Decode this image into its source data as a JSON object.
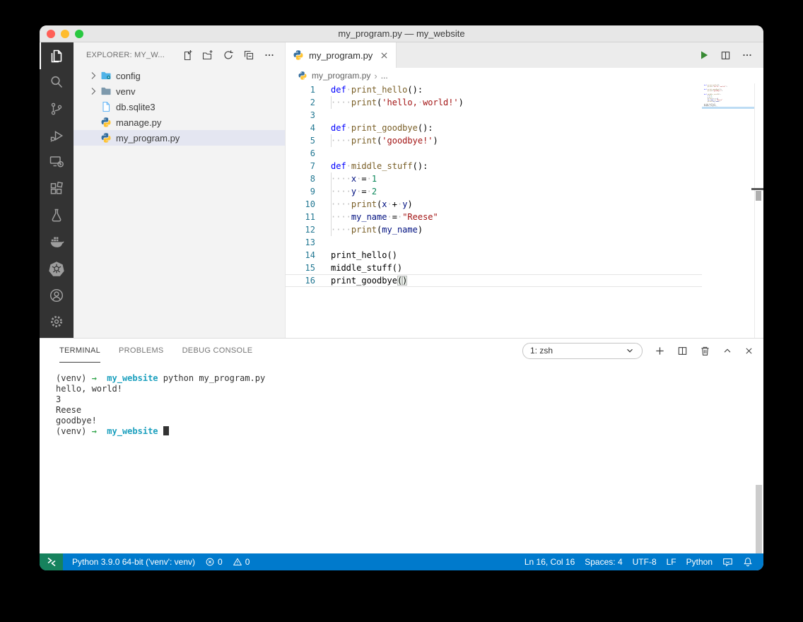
{
  "window": {
    "title": "my_program.py — my_website"
  },
  "activity_bar": {
    "items": [
      {
        "id": "explorer",
        "label": "Explorer",
        "active": true
      },
      {
        "id": "search",
        "label": "Search",
        "active": false
      },
      {
        "id": "source-control",
        "label": "Source Control",
        "active": false
      },
      {
        "id": "run-debug",
        "label": "Run and Debug",
        "active": false
      },
      {
        "id": "remote-explorer",
        "label": "Remote Explorer",
        "active": false
      },
      {
        "id": "extensions",
        "label": "Extensions",
        "active": false
      },
      {
        "id": "testing",
        "label": "Testing",
        "active": false
      },
      {
        "id": "docker",
        "label": "Docker",
        "active": false
      },
      {
        "id": "kubernetes",
        "label": "Kubernetes",
        "active": false
      }
    ],
    "bottom": [
      {
        "id": "accounts",
        "label": "Accounts",
        "active": false
      },
      {
        "id": "settings",
        "label": "Manage",
        "active": false
      }
    ]
  },
  "sidebar": {
    "title": "EXPLORER: MY_W...",
    "actions": [
      "new-file",
      "new-folder",
      "refresh",
      "collapse-all",
      "more"
    ],
    "tree": [
      {
        "label": "config",
        "icon": "folder-config",
        "chevron": true,
        "selected": false
      },
      {
        "label": "venv",
        "icon": "folder",
        "chevron": true,
        "selected": false
      },
      {
        "label": "db.sqlite3",
        "icon": "file",
        "chevron": false,
        "selected": false
      },
      {
        "label": "manage.py",
        "icon": "python",
        "chevron": false,
        "selected": false
      },
      {
        "label": "my_program.py",
        "icon": "python",
        "chevron": false,
        "selected": true
      }
    ]
  },
  "editor": {
    "tab": {
      "label": "my_program.py",
      "icon": "python"
    },
    "actions": [
      "run",
      "split-editor",
      "more"
    ],
    "breadcrumb": {
      "file": "my_program.py",
      "more": "..."
    },
    "code": [
      {
        "n": 1,
        "tokens": [
          [
            "kw",
            "def"
          ],
          [
            "ws",
            "·"
          ],
          [
            "fn",
            "print_hello"
          ],
          [
            "pl",
            "():"
          ]
        ]
      },
      {
        "n": 2,
        "indent": true,
        "tokens": [
          [
            "ws",
            "····"
          ],
          [
            "fn",
            "print"
          ],
          [
            "pl",
            "("
          ],
          [
            "str",
            "'hello,"
          ],
          [
            "ws",
            "·"
          ],
          [
            "str",
            "world!'"
          ],
          [
            "pl",
            ")"
          ]
        ]
      },
      {
        "n": 3,
        "tokens": []
      },
      {
        "n": 4,
        "tokens": [
          [
            "kw",
            "def"
          ],
          [
            "ws",
            "·"
          ],
          [
            "fn",
            "print_goodbye"
          ],
          [
            "pl",
            "():"
          ]
        ]
      },
      {
        "n": 5,
        "indent": true,
        "tokens": [
          [
            "ws",
            "····"
          ],
          [
            "fn",
            "print"
          ],
          [
            "pl",
            "("
          ],
          [
            "str",
            "'goodbye!'"
          ],
          [
            "pl",
            ")"
          ]
        ]
      },
      {
        "n": 6,
        "tokens": []
      },
      {
        "n": 7,
        "tokens": [
          [
            "kw",
            "def"
          ],
          [
            "ws",
            "·"
          ],
          [
            "fn",
            "middle_stuff"
          ],
          [
            "pl",
            "():"
          ]
        ]
      },
      {
        "n": 8,
        "indent": true,
        "tokens": [
          [
            "ws",
            "····"
          ],
          [
            "var",
            "x"
          ],
          [
            "ws",
            "·"
          ],
          [
            "pl",
            "="
          ],
          [
            "ws",
            "·"
          ],
          [
            "num",
            "1"
          ]
        ]
      },
      {
        "n": 9,
        "indent": true,
        "tokens": [
          [
            "ws",
            "····"
          ],
          [
            "var",
            "y"
          ],
          [
            "ws",
            "·"
          ],
          [
            "pl",
            "="
          ],
          [
            "ws",
            "·"
          ],
          [
            "num",
            "2"
          ]
        ]
      },
      {
        "n": 10,
        "indent": true,
        "tokens": [
          [
            "ws",
            "····"
          ],
          [
            "fn",
            "print"
          ],
          [
            "pl",
            "("
          ],
          [
            "var",
            "x"
          ],
          [
            "ws",
            "·"
          ],
          [
            "pl",
            "+"
          ],
          [
            "ws",
            "·"
          ],
          [
            "var",
            "y"
          ],
          [
            "pl",
            ")"
          ]
        ]
      },
      {
        "n": 11,
        "indent": true,
        "tokens": [
          [
            "ws",
            "····"
          ],
          [
            "var",
            "my_name"
          ],
          [
            "ws",
            "·"
          ],
          [
            "pl",
            "="
          ],
          [
            "ws",
            "·"
          ],
          [
            "str",
            "\"Reese\""
          ]
        ]
      },
      {
        "n": 12,
        "indent": true,
        "tokens": [
          [
            "ws",
            "····"
          ],
          [
            "fn",
            "print"
          ],
          [
            "pl",
            "("
          ],
          [
            "var",
            "my_name"
          ],
          [
            "pl",
            ")"
          ]
        ]
      },
      {
        "n": 13,
        "tokens": []
      },
      {
        "n": 14,
        "tokens": [
          [
            "pl",
            "print_hello()"
          ]
        ]
      },
      {
        "n": 15,
        "tokens": [
          [
            "pl",
            "middle_stuff()"
          ]
        ]
      },
      {
        "n": 16,
        "current": true,
        "tokens": [
          [
            "pl",
            "print_goodbye"
          ],
          [
            "bm",
            "("
          ],
          [
            "bm",
            ")"
          ]
        ]
      }
    ]
  },
  "panel": {
    "tabs": [
      {
        "label": "TERMINAL",
        "active": true
      },
      {
        "label": "PROBLEMS",
        "active": false
      },
      {
        "label": "DEBUG CONSOLE",
        "active": false
      }
    ],
    "shell_select": "1: zsh",
    "controls": [
      "add",
      "split-panel",
      "trash",
      "chevron-up",
      "close"
    ],
    "terminal": [
      [
        [
          "tp",
          "(venv) "
        ],
        [
          "ta",
          "→"
        ],
        [
          "tp",
          "  "
        ],
        [
          "td",
          "my_website"
        ],
        [
          "tp",
          " python my_program.py"
        ]
      ],
      [
        [
          "tp",
          "hello, world!"
        ]
      ],
      [
        [
          "tp",
          "3"
        ]
      ],
      [
        [
          "tp",
          "Reese"
        ]
      ],
      [
        [
          "tp",
          "goodbye!"
        ]
      ],
      [
        [
          "tp",
          "(venv) "
        ],
        [
          "ta",
          "→"
        ],
        [
          "tp",
          "  "
        ],
        [
          "td",
          "my_website"
        ],
        [
          "tp",
          " "
        ],
        [
          "cur",
          ""
        ]
      ]
    ]
  },
  "status_bar": {
    "left": [
      {
        "icon": "remote",
        "badge": true,
        "label": ""
      },
      {
        "label": "Python 3.9.0 64-bit ('venv': venv)"
      },
      {
        "icon": "error",
        "label": "0"
      },
      {
        "icon": "warning",
        "label": "0"
      }
    ],
    "right": [
      {
        "label": "Ln 16, Col 16"
      },
      {
        "label": "Spaces: 4"
      },
      {
        "label": "UTF-8"
      },
      {
        "label": "LF"
      },
      {
        "label": "Python"
      },
      {
        "icon": "feedback",
        "label": ""
      },
      {
        "icon": "bell",
        "label": ""
      }
    ]
  },
  "colors": {
    "status_bar": "#007ACC",
    "remote_badge": "#16825D",
    "traffic_lights": [
      "#FF5F57",
      "#FEBC2E",
      "#28C840"
    ],
    "keyword": "#0000FF",
    "function": "#795E26",
    "string": "#A31515",
    "number": "#098658",
    "variable": "#001080",
    "line_number": "#237893",
    "terminal_dir": "#1CA0BE",
    "terminal_arrow": "#3BA953"
  }
}
